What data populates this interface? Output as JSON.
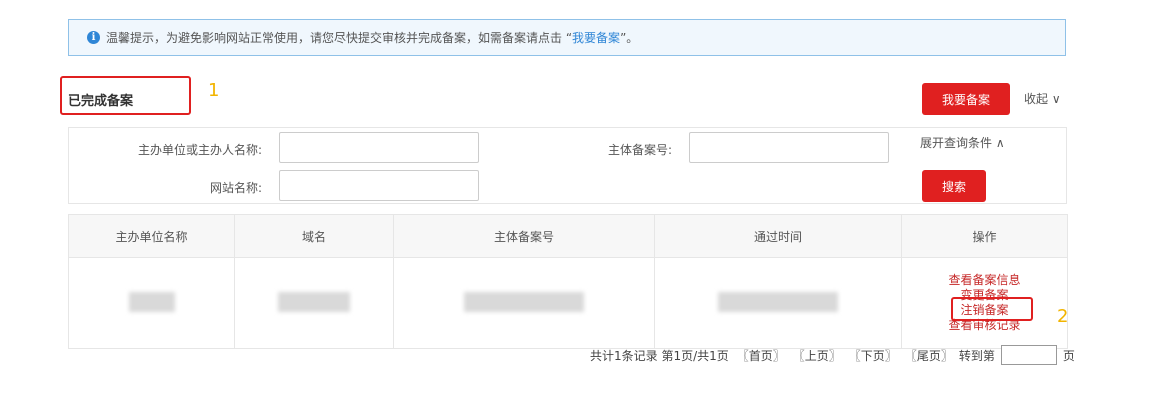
{
  "notice": {
    "text": "温馨提示，为避免影响网站正常使用，请您尽快提交审核并完成备案，如需备案请点击 “",
    "link": "我要备案",
    "suffix": "”。"
  },
  "section": {
    "title": "已完成备案"
  },
  "annotations": {
    "one": "1",
    "two": "2"
  },
  "actions": {
    "apply_label": "我要备案",
    "collapse_label": "收起 ∨"
  },
  "search": {
    "owner_label": "主办单位或主办人名称:",
    "record_no_label": "主体备案号:",
    "site_name_label": "网站名称:",
    "expand_label": "展开查询条件 ∧",
    "search_label": "搜索"
  },
  "table": {
    "headers": [
      "主办单位名称",
      "域名",
      "主体备案号",
      "通过时间",
      "操作"
    ],
    "ops": [
      "查看备案信息",
      "变更备案",
      "注销备案",
      "查看审核记录"
    ]
  },
  "pager": {
    "summary": "共计1条记录 第1页/共1页",
    "first": "〖首页〗",
    "prev": "〖上页〗",
    "next": "〖下页〗",
    "last": "〖尾页〗",
    "goto": "转到第",
    "page_unit": "页"
  }
}
